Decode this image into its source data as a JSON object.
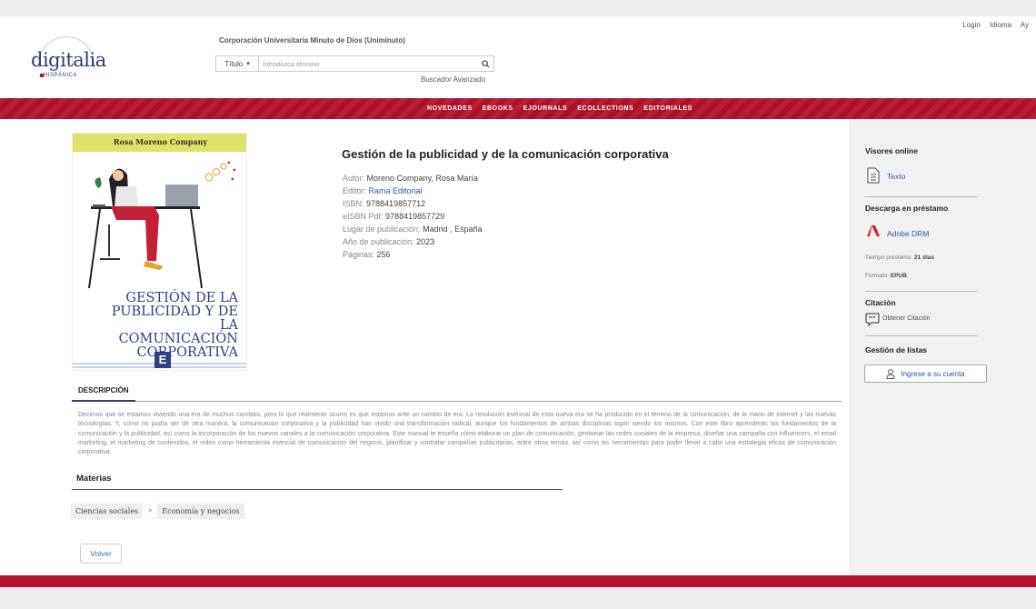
{
  "toplinks": [
    "Login",
    "Idioma",
    "Ay"
  ],
  "logo": {
    "word": "digitalia",
    "sub": "HISPÁNICA"
  },
  "institution": "Corporación Universitaria Minuto de Dios (Uniminuto)",
  "search": {
    "select_value": "Título",
    "placeholder": "Introduzca término",
    "advanced": "Buscador Avanzado"
  },
  "nav": [
    "NOVEDADES",
    "EBOOKS",
    "EJOURNALS",
    "ECOLLECTIONS",
    "EDITORIALES"
  ],
  "cover": {
    "author": "Rosa Moreno Company",
    "title": "GESTIÓN DE LA PUBLICIDAD Y DE LA COMUNICACIÓN CORPORATIVA"
  },
  "book": {
    "title": "Gestión de la publicidad y de la comunicación corporativa",
    "meta": [
      {
        "label": "Autor:",
        "value": "Moreno Company, Rosa María",
        "link": false
      },
      {
        "label": "Editor:",
        "value": "Rama Editorial",
        "link": true
      },
      {
        "label": "ISBN:",
        "value": "9788419857712",
        "link": false
      },
      {
        "label": "eISBN Pdf:",
        "value": "9788419857729",
        "link": false
      },
      {
        "label": "Lugar de publicación:",
        "value": " Madrid , España",
        "link": false
      },
      {
        "label": "Año de publicación:",
        "value": "2023",
        "link": false
      },
      {
        "label": "Páginas:",
        "value": "256",
        "link": false
      }
    ]
  },
  "description": {
    "tab": "DESCRIPCIÓN",
    "text": "Decimos que se estamos viviendo una era de muchos cambios, pero lo que realmente ocurre es que estamos ante un cambio de era. La revolución esencial de esta nueva era se ha producido en el terreno de la comunicación, de la mano de internet y las nuevas tecnologías. Y, como no podía ser de otra manera, la comunicación corporativa y la publicidad han vivido una transformación radical, aunque los fundamentos de ambas disciplinas sigan siendo los mismos. Con este libro aprenderás los fundamentos de la comunicación y la publicidad, así como la incorporación de los nuevos canales a la comunicación corporativa. Este manual te enseña cómo elaborar un plan de comunicación, gestionar las redes sociales de la empresa, diseñar una campaña con influencers, el email marketing, el marketing de contenidos, el vídeo como herramienta esencial de comunicación del negocio, planificar y contratar campañas publicitarias, entre otros temas, así como las herramientas para poder llevar a cabo una estrategia eficaz de comunicación corporativa."
  },
  "materias": {
    "title": "Materias",
    "crumbs": [
      "Ciencias sociales",
      "Economía y negocios"
    ],
    "sep": ">"
  },
  "back": "Volver",
  "sidebar": {
    "viewers_title": "Visores online",
    "viewer_text": "Texto",
    "loan_title": "Descarga en préstamo",
    "adobe": "Adobe DRM",
    "loan_time_label": "Tiempo préstamo:",
    "loan_time_value": "21 días",
    "format_label": "Formato:",
    "format_value": "EPUB",
    "citation_title": "Citación",
    "citation_link": "Obtener Citación",
    "lists_title": "Gestión de listas",
    "login_button": "Ingrese a su cuenta"
  }
}
